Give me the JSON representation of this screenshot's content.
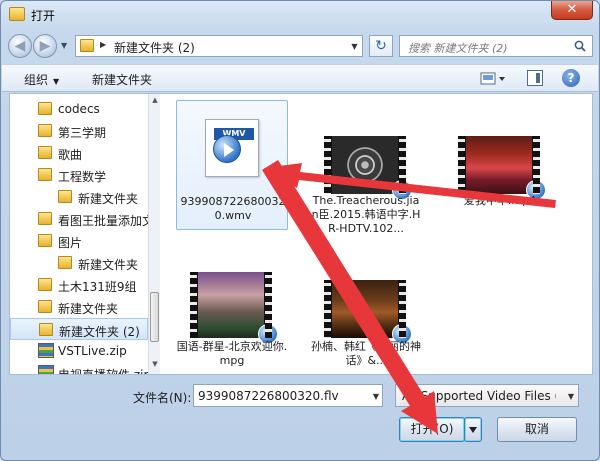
{
  "window": {
    "title": "打开",
    "close_label": "✕"
  },
  "address": {
    "path": "新建文件夹 (2)",
    "search_placeholder": "搜索 新建文件夹 (2)"
  },
  "toolbar": {
    "organize_label": "组织",
    "new_folder_label": "新建文件夹",
    "help_label": "?"
  },
  "nav_items": [
    {
      "label": "codecs",
      "type": "folder",
      "indent": 0
    },
    {
      "label": "第三学期",
      "type": "folder",
      "indent": 0
    },
    {
      "label": "歌曲",
      "type": "folder",
      "indent": 0
    },
    {
      "label": "工程数学",
      "type": "folder",
      "indent": 0
    },
    {
      "label": "新建文件夹",
      "type": "folder",
      "indent": 1
    },
    {
      "label": "看图王批量添加文",
      "type": "folder",
      "indent": 0
    },
    {
      "label": "图片",
      "type": "folder",
      "indent": 0
    },
    {
      "label": "新建文件夹",
      "type": "folder",
      "indent": 1
    },
    {
      "label": "土木131班9组",
      "type": "folder",
      "indent": 0
    },
    {
      "label": "新建文件夹",
      "type": "folder",
      "indent": 0
    },
    {
      "label": "新建文件夹 (2)",
      "type": "folder",
      "indent": 0,
      "selected": true
    },
    {
      "label": "VSTLive.zip",
      "type": "zip",
      "indent": 0
    },
    {
      "label": "电视直播软件.zip",
      "type": "zip",
      "indent": 0
    }
  ],
  "files": [
    {
      "name": "9399087226800320.wmv",
      "kind": "wmv",
      "selected": true
    },
    {
      "name": "The.Treacherous.jian臣.2015.韩语中字.HR-HDTV.102...",
      "kind": "video"
    },
    {
      "name": "爱我中华.mp4",
      "kind": "video"
    },
    {
      "name": "国语-群星-北京欢迎你.mpg",
      "kind": "video"
    },
    {
      "name": "孙楠、韩红《美丽的神话》&...",
      "kind": "video"
    }
  ],
  "bottom": {
    "filename_label": "文件名(N):",
    "filename_value": "9399087226800320.flv",
    "filetype_value": "All Supported Video Files (*.",
    "open_label": "打开(O)",
    "cancel_label": "取消"
  },
  "colors": {
    "accent": "#2f74c7",
    "annotation": "#e8373a",
    "folder": "#e8b22f"
  }
}
